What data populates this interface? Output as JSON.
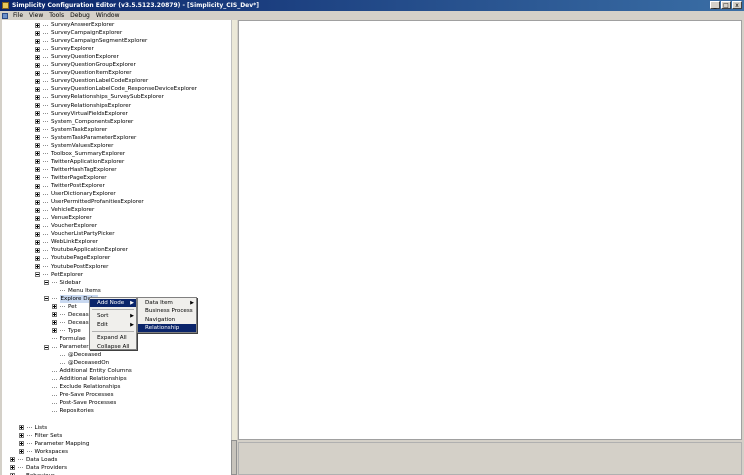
{
  "window": {
    "title": "Simplicity Configuration Editor (v3.5.5123.20879) - [Simplicity_CIS_Dev*]",
    "min": "_",
    "max": "□",
    "close": "x"
  },
  "menubar": [
    "File",
    "View",
    "Tools",
    "Debug",
    "Window"
  ],
  "tree": [
    {
      "label": "SurveyAnswerExplorer",
      "d": 2,
      "e": "plus"
    },
    {
      "label": "SurveyCampaignExplorer",
      "d": 2,
      "e": "plus"
    },
    {
      "label": "SurveyCampaignSegmentExplorer",
      "d": 2,
      "e": "plus"
    },
    {
      "label": "SurveyExplorer",
      "d": 2,
      "e": "plus"
    },
    {
      "label": "SurveyQuestionExplorer",
      "d": 2,
      "e": "plus"
    },
    {
      "label": "SurveyQuestionGroupExplorer",
      "d": 2,
      "e": "plus"
    },
    {
      "label": "SurveyQuestionItemExplorer",
      "d": 2,
      "e": "plus"
    },
    {
      "label": "SurveyQuestionLabelCodeExplorer",
      "d": 2,
      "e": "plus"
    },
    {
      "label": "SurveyQuestionLabelCode_ResponseDeviceExplorer",
      "d": 2,
      "e": "plus"
    },
    {
      "label": "SurveyRelationships_SurveySubExplorer",
      "d": 2,
      "e": "plus"
    },
    {
      "label": "SurveyRelationshipsExplorer",
      "d": 2,
      "e": "plus"
    },
    {
      "label": "SurveyVirtualFieldsExplorer",
      "d": 2,
      "e": "plus"
    },
    {
      "label": "System_ComponentsExplorer",
      "d": 2,
      "e": "plus"
    },
    {
      "label": "SystemTaskExplorer",
      "d": 2,
      "e": "plus"
    },
    {
      "label": "SystemTaskParameterExplorer",
      "d": 2,
      "e": "plus"
    },
    {
      "label": "SystemValuesExplorer",
      "d": 2,
      "e": "plus"
    },
    {
      "label": "Toolbox_SummaryExplorer",
      "d": 2,
      "e": "plus"
    },
    {
      "label": "TwitterApplicationExplorer",
      "d": 2,
      "e": "plus"
    },
    {
      "label": "TwitterHashTagExplorer",
      "d": 2,
      "e": "plus"
    },
    {
      "label": "TwitterPageExplorer",
      "d": 2,
      "e": "plus"
    },
    {
      "label": "TwitterPostExplorer",
      "d": 2,
      "e": "plus"
    },
    {
      "label": "UserDictionaryExplorer",
      "d": 2,
      "e": "plus"
    },
    {
      "label": "UserPermittedProfanitiesExplorer",
      "d": 2,
      "e": "plus"
    },
    {
      "label": "VehicleExplorer",
      "d": 2,
      "e": "plus"
    },
    {
      "label": "VenueExplorer",
      "d": 2,
      "e": "plus"
    },
    {
      "label": "VoucherExplorer",
      "d": 2,
      "e": "plus"
    },
    {
      "label": "VoucherListPartyPicker",
      "d": 2,
      "e": "plus"
    },
    {
      "label": "WebLinkExplorer",
      "d": 2,
      "e": "plus"
    },
    {
      "label": "YoutubeApplicationExplorer",
      "d": 2,
      "e": "plus"
    },
    {
      "label": "YoutubePageExplorer",
      "d": 2,
      "e": "plus"
    },
    {
      "label": "YoutubePostExplorer",
      "d": 2,
      "e": "plus"
    },
    {
      "label": "PetExplorer",
      "d": 2,
      "e": "minus"
    },
    {
      "label": "Sidebar",
      "d": 3,
      "e": "minus"
    },
    {
      "label": "Menu Items",
      "d": 4,
      "e": "dash"
    },
    {
      "label": "Explore Data",
      "d": 3,
      "e": "minus",
      "sel": true
    },
    {
      "label": "Pet",
      "d": 4,
      "e": "plus"
    },
    {
      "label": "Deceased",
      "d": 4,
      "e": "plus"
    },
    {
      "label": "Deceased",
      "d": 4,
      "e": "plus"
    },
    {
      "label": "Type",
      "d": 4,
      "e": "plus"
    },
    {
      "label": "Formulae",
      "d": 3,
      "e": "dash"
    },
    {
      "label": "Parameters",
      "d": 3,
      "e": "minus"
    },
    {
      "label": "@Deceased",
      "d": 4,
      "e": "dash"
    },
    {
      "label": "@DeceasedOn",
      "d": 4,
      "e": "dash"
    },
    {
      "label": "Additional Entity Columns",
      "d": 3,
      "e": "dash"
    },
    {
      "label": "Additional Relationships",
      "d": 3,
      "e": "dash"
    },
    {
      "label": "Exclude Relationships",
      "d": 3,
      "e": "dash"
    },
    {
      "label": "Pre-Save Processes",
      "d": 3,
      "e": "dash"
    },
    {
      "label": "Post-Save Processes",
      "d": 3,
      "e": "dash"
    },
    {
      "label": "Repositories",
      "d": 3,
      "e": "dash"
    },
    {
      "label": "",
      "d": 3,
      "e": "none"
    },
    {
      "label": "Lists",
      "d": 1,
      "e": "plus"
    },
    {
      "label": "Filter Sets",
      "d": 1,
      "e": "plus"
    },
    {
      "label": "Parameter Mapping",
      "d": 1,
      "e": "plus"
    },
    {
      "label": "Workspaces",
      "d": 1,
      "e": "plus"
    },
    {
      "label": "Data Loads",
      "d": 0,
      "e": "plus"
    },
    {
      "label": "Data Providers",
      "d": 0,
      "e": "plus"
    },
    {
      "label": "Behaviour",
      "d": 0,
      "e": "plus"
    }
  ],
  "context_menu": {
    "items": [
      {
        "label": "Add Node",
        "arrow": "▶",
        "hl": true
      },
      {
        "label": "",
        "sep": true
      },
      {
        "label": "Sort",
        "arrow": "▶"
      },
      {
        "label": "Edit",
        "arrow": "▶"
      },
      {
        "label": "",
        "sep": true
      },
      {
        "label": "Expand All"
      },
      {
        "label": "Collapse All"
      }
    ]
  },
  "submenu": {
    "items": [
      {
        "label": "Data Item",
        "arrow": "▶"
      },
      {
        "label": "Business Process"
      },
      {
        "label": "Navigation"
      },
      {
        "label": "Relationship",
        "hl": true
      }
    ]
  }
}
